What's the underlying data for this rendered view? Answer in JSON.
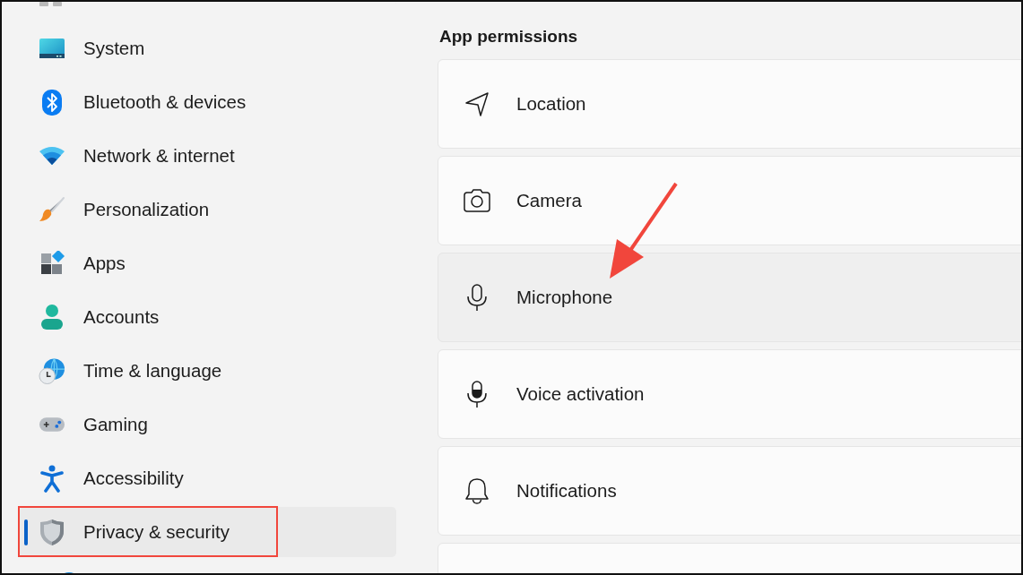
{
  "sidebar": {
    "items": [
      {
        "label": "System",
        "selected": false,
        "highlighted": false
      },
      {
        "label": "Bluetooth & devices",
        "selected": false,
        "highlighted": false
      },
      {
        "label": "Network & internet",
        "selected": false,
        "highlighted": false
      },
      {
        "label": "Personalization",
        "selected": false,
        "highlighted": false
      },
      {
        "label": "Apps",
        "selected": false,
        "highlighted": false
      },
      {
        "label": "Accounts",
        "selected": false,
        "highlighted": false
      },
      {
        "label": "Time & language",
        "selected": false,
        "highlighted": false
      },
      {
        "label": "Gaming",
        "selected": false,
        "highlighted": false
      },
      {
        "label": "Accessibility",
        "selected": false,
        "highlighted": false
      },
      {
        "label": "Privacy & security",
        "selected": true,
        "highlighted": true
      }
    ]
  },
  "section": {
    "title": "App permissions",
    "items": [
      {
        "label": "Location",
        "hovered": false
      },
      {
        "label": "Camera",
        "hovered": false
      },
      {
        "label": "Microphone",
        "hovered": true
      },
      {
        "label": "Voice activation",
        "hovered": false
      },
      {
        "label": "Notifications",
        "hovered": false
      }
    ]
  }
}
